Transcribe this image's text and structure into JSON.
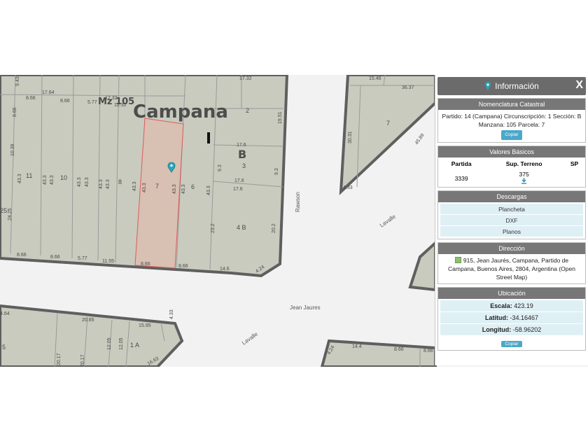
{
  "map": {
    "city_label": "Campana",
    "manzana_label": "Mz 105",
    "block_letter": "B",
    "streets": {
      "rawson": "Rawson",
      "lavalle_1": "Lavalle",
      "lavalle_2": "Lavalle",
      "jean_jaures": "Jean Jaures"
    },
    "parcel_numbers": {
      "p11": "11",
      "p10": "10",
      "p8": "8",
      "p7": "7",
      "p6": "6",
      "p3": "3",
      "p2": "2",
      "p4b": "4 B",
      "p7ne": "7",
      "p5": "5",
      "p1a": "1 A",
      "p25": "25"
    },
    "dims": {
      "d1732": "17.32",
      "d1764": "17.64",
      "d866a": "8.66",
      "d866b": "8.66",
      "d577": "5.77",
      "d1732b": "17.32",
      "d1232": "12.32",
      "d1951": "19.51",
      "d176a": "17.6",
      "d176b": "17.6",
      "d93a": "9.3",
      "d93b": "9.3",
      "d433a": "43.3",
      "d433b": "43.3",
      "d433c": "43.3",
      "d433d": "43.3",
      "d433e": "43.3",
      "d433f": "43.3",
      "d433g": "43.3",
      "d433h": "43.3",
      "d433i": "43.3",
      "d433j": "43.3",
      "d232": "23.2",
      "d202": "20.2",
      "d866c": "8.66",
      "d866d": "8.66",
      "d577b": "5.77",
      "d1155": "11.55",
      "d866e": "8.66",
      "d866f": "8.66",
      "d146": "14.6",
      "d424": "4.24",
      "d943": "9.43",
      "d866g": "8.66",
      "d1039": "10.39",
      "d2425": "24.25",
      "d1546": "15.46",
      "d3637": "36.37",
      "d3031": "30.31",
      "d4589": "45.89",
      "d433k": "4.33",
      "d464": "4.64",
      "d2085": "20.85",
      "d1595": "15.95",
      "d433l": "4.33",
      "d2017a": "20.17",
      "d2017b": "20.17",
      "d1205a": "12.05",
      "d1205b": "12.05",
      "d1663": "16.63",
      "d424b": "4.24",
      "d144": "14.4",
      "d866h": "8.66",
      "d866i": "8.66"
    }
  },
  "panel": {
    "title": "Información",
    "close_label": "X",
    "nomenclatura": {
      "title": "Nomenclatura Catastral",
      "text": "Partido: 14 (Campana) Circunscripción: 1 Sección: B Manzana: 105 Parcela: 7",
      "copy_label": "Copiar"
    },
    "valores": {
      "title": "Valores Básicos",
      "headers": [
        "Partida",
        "Sup. Terreno",
        "SP"
      ],
      "row": [
        "3339",
        "375",
        ""
      ]
    },
    "descargas": {
      "title": "Descargas",
      "items": [
        "Plancheta",
        "DXF",
        "Planos"
      ]
    },
    "direccion": {
      "title": "Dirección",
      "text": "915, Jean Jaurés, Campana, Partido de Campana, Buenos Aires, 2804, Argentina (Open Street Map)"
    },
    "ubicacion": {
      "title": "Ubicación",
      "escala_label": "Escala:",
      "escala_value": "423.19",
      "latitud_label": "Latitud:",
      "latitud_value": "-34.16467",
      "longitud_label": "Longitud:",
      "longitud_value": "-58.96202",
      "copy_label": "Copiar"
    }
  },
  "colors": {
    "block_fill": "#c9cbbe",
    "block_edge": "#5f5f5f",
    "parcel_line": "#9a9a9a",
    "selected_fill": "#d8c0b2",
    "selected_edge": "#e05a5a",
    "marker": "#2aa8b8"
  }
}
